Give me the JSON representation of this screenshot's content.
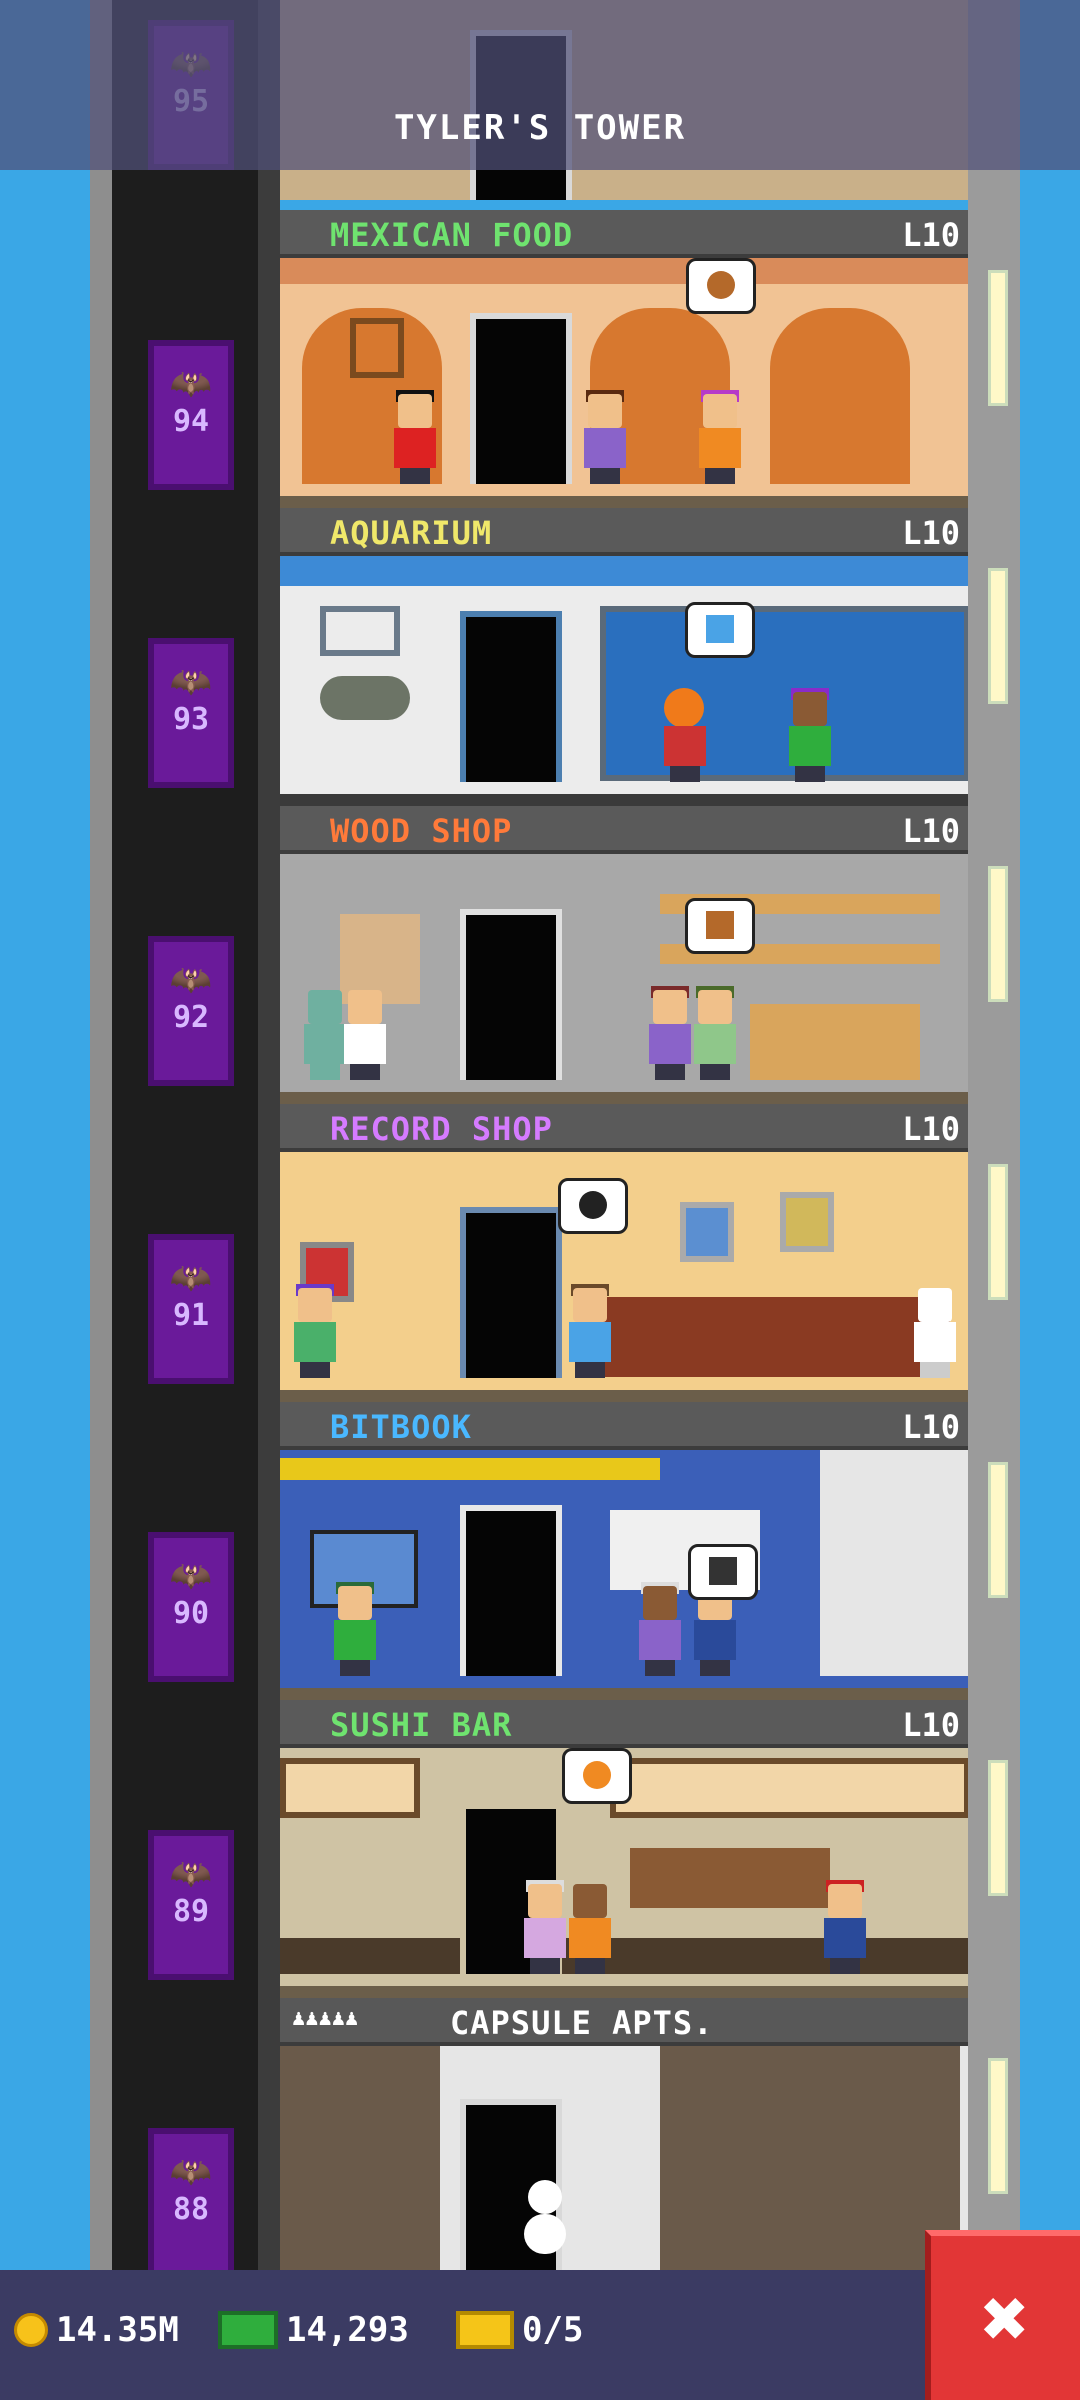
{
  "header": {
    "title": "TYLER'S TOWER"
  },
  "elevator": {
    "cars": [
      "95",
      "94",
      "93",
      "92",
      "91",
      "90",
      "89",
      "88"
    ]
  },
  "floors": [
    {
      "name": "MEXICAN FOOD",
      "level": "L10",
      "color": "#6fe36f",
      "bg": "#f1c394"
    },
    {
      "name": "AQUARIUM",
      "level": "L10",
      "color": "#f0e86a",
      "bg": "#e8e8e8"
    },
    {
      "name": "WOOD SHOP",
      "level": "L10",
      "color": "#ff7a3a",
      "bg": "#a8a8a8"
    },
    {
      "name": "RECORD SHOP",
      "level": "L10",
      "color": "#d57bff",
      "bg": "#f3cf8c"
    },
    {
      "name": "BITBOOK",
      "level": "L10",
      "color": "#4ab8ff",
      "bg": "#3b5fb8"
    },
    {
      "name": "SUSHI BAR",
      "level": "L10",
      "color": "#6fe36f",
      "bg": "#cfc3a4"
    },
    {
      "name": "CAPSULE APTS.",
      "level": "",
      "color": "#ffffff",
      "bg": "#e6e6e6"
    }
  ],
  "bottom_bar": {
    "coins": "14.35M",
    "bux": "14,293",
    "tickets": "0/5"
  },
  "close": {
    "label": "✖"
  }
}
